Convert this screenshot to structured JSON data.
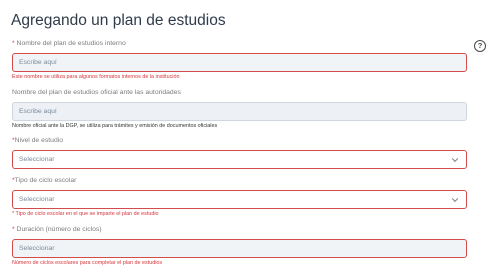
{
  "page": {
    "title": "Agregando un plan de estudios",
    "help_icon": "question-circle-icon",
    "help_glyph": "?"
  },
  "fields": {
    "internal_name": {
      "required_mark": "*",
      "label": " Nombre del plan de estudios interno",
      "placeholder": "Escribe aquí",
      "hint": "Este nombre se utiliza para algunos formatos internos de la institución"
    },
    "official_name": {
      "label": "Nombre del plan de estudios oficial ante las autoridades",
      "placeholder": "Escribe aquí",
      "hint": "Nombre oficial ante la DGP, se utiliza para trámites y emisión de documentos oficiales"
    },
    "level": {
      "required_mark": "*",
      "label": "Nivel de estudio",
      "placeholder": "Seleccionar",
      "chevron_icon": "chevron-down-icon"
    },
    "cycle_type": {
      "required_mark": "*",
      "label": "Tipo de ciclo escolar",
      "placeholder": "Seleccionar",
      "chevron_icon": "chevron-down-icon",
      "hint": "* Tipo de ciclo escolar en el que se imparte el plan de estudio"
    },
    "duration": {
      "required_mark": "*",
      "label": " Duración (número de ciclos)",
      "placeholder": "Seleccionar",
      "hint": "Número de ciclos escolares para completar el plan de estudios"
    }
  },
  "colors": {
    "error": "#d4363b",
    "error_border": "#d44b4b",
    "input_bg": "#edf1f5",
    "title": "#2f3b4a"
  }
}
